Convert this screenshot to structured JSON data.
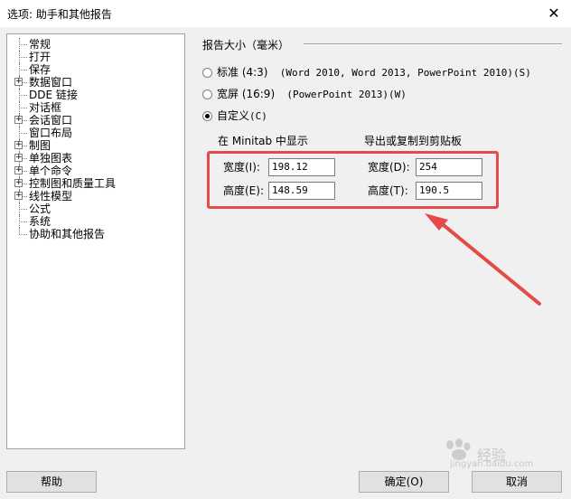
{
  "window": {
    "title": "选项: 助手和其他报告",
    "close_icon": "close-icon"
  },
  "tree": {
    "items": [
      {
        "label": "常规",
        "expandable": false
      },
      {
        "label": "打开",
        "expandable": false
      },
      {
        "label": "保存",
        "expandable": false
      },
      {
        "label": "数据窗口",
        "expandable": true
      },
      {
        "label": "DDE 链接",
        "expandable": false
      },
      {
        "label": "对话框",
        "expandable": false
      },
      {
        "label": "会话窗口",
        "expandable": true
      },
      {
        "label": "窗口布局",
        "expandable": false
      },
      {
        "label": "制图",
        "expandable": true
      },
      {
        "label": "单独图表",
        "expandable": true
      },
      {
        "label": "单个命令",
        "expandable": true
      },
      {
        "label": "控制图和质量工具",
        "expandable": true
      },
      {
        "label": "线性模型",
        "expandable": true
      },
      {
        "label": "公式",
        "expandable": false
      },
      {
        "label": "系统",
        "expandable": false
      },
      {
        "label": "协助和其他报告",
        "expandable": false
      }
    ]
  },
  "report_size": {
    "header": "报告大小（毫米）",
    "options": [
      {
        "label": "标准 (4:3)",
        "detail": "(Word 2010, Word 2013, PowerPoint 2010)",
        "accel": "(S)",
        "selected": false
      },
      {
        "label": "宽屏 (16:9)",
        "detail": "(PowerPoint 2013)",
        "accel": "(W)",
        "selected": false
      },
      {
        "label": "自定义",
        "detail": "",
        "accel": "(C)",
        "selected": true
      }
    ],
    "minitab": {
      "header": "在 Minitab 中显示",
      "width_label": "宽度(I):",
      "width_value": "198.12",
      "height_label": "高度(E):",
      "height_value": "148.59"
    },
    "clipboard": {
      "header": "导出或复制到剪贴板",
      "width_label": "宽度(D):",
      "width_value": "254",
      "height_label": "高度(T):",
      "height_value": "190.5"
    }
  },
  "buttons": {
    "help": "帮助",
    "ok": "确定(O)",
    "cancel": "取消"
  },
  "watermark": {
    "text": "经验",
    "url": "jingyan.baidu.com"
  },
  "colors": {
    "annotation_red": "#e34a48",
    "dialog_bg": "#f0f0f0"
  }
}
